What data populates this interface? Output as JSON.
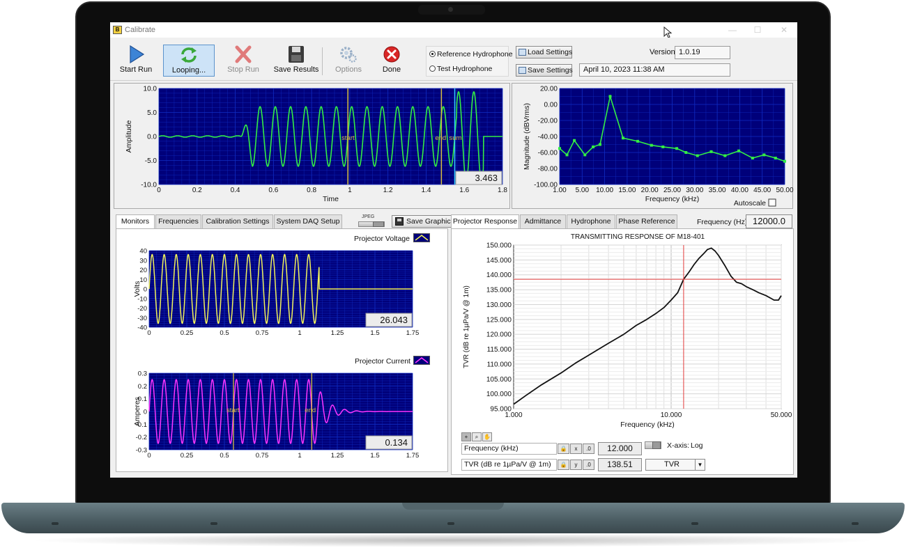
{
  "window": {
    "title": "Calibrate",
    "minimize": "—",
    "maximize": "☐",
    "close": "✕"
  },
  "toolbar": {
    "start_run": "Start Run",
    "looping": "Looping...",
    "stop_run": "Stop Run",
    "save_results": "Save Results",
    "options": "Options",
    "done": "Done",
    "load_settings": "Load Settings",
    "save_settings": "Save Settings",
    "version_label": "Version",
    "version_value": "1.0.19",
    "datetime_value": "April 10, 2023    11:38 AM"
  },
  "hydrophone": {
    "options": [
      "Reference Hydrophone",
      "Test Hydrophone"
    ],
    "selected": "Reference Hydrophone"
  },
  "left_tabs": [
    "Monitors",
    "Frequencies",
    "Calibration Settings",
    "System DAQ Setup"
  ],
  "left_active_tab": "Monitors",
  "save_graphic": {
    "format_label": "JPEG",
    "button": "Save Graphic"
  },
  "right_tabs": [
    "Projector Response",
    "Admittance",
    "Hydrophone",
    "Phase Reference"
  ],
  "right_active_tab": "Projector Response",
  "frequency_control": {
    "label": "Frequency (Hz)",
    "value": "12000.0"
  },
  "tvr_cursors": {
    "rows": [
      {
        "name": "Frequency (kHz)",
        "value": "12.000"
      },
      {
        "name": "TVR (dB re 1µPa/V @ 1m)",
        "value": "138.51"
      }
    ],
    "xaxis_label": "X-axis:",
    "xaxis_value": "Log",
    "ring_value": "TVR"
  },
  "colors": {
    "plot_bg": "#00007a",
    "plot_grid": "#0f2cc4",
    "green_trace": "#33ee44",
    "yellow_trace": "#f3f35a",
    "magenta_trace": "#ff33ff",
    "cursor_yellow": "#d8c040",
    "cursor_cyan": "#33ccff",
    "cursor_red": "#e23c3c"
  },
  "chart_data": [
    {
      "id": "amplitude-chart",
      "type": "line",
      "xlabel": "Time",
      "ylabel": "Amplitude",
      "xlim": [
        0,
        1.8
      ],
      "ylim": [
        -10,
        10
      ],
      "xticks": [
        "0",
        "0.2",
        "0.4",
        "0.6",
        "0.8",
        "1",
        "1.2",
        "1.4",
        "1.6",
        "1.8"
      ],
      "yticks": [
        "10.0",
        "5.0",
        "0.0",
        "-5.0",
        "-10.0"
      ],
      "signal": {
        "onset": 0.43,
        "frequency_cycles_per_unit": 12.5,
        "amplitude": 6.2,
        "late_amplitude": 9.3
      },
      "cursors": [
        {
          "label": "start",
          "x": 0.99
        },
        {
          "label": "end",
          "x": 1.48
        },
        {
          "label": "sum",
          "x": 1.55
        }
      ],
      "readout": "3.463"
    },
    {
      "id": "spectrum-chart",
      "type": "line",
      "xlabel": "Frequency (kHz)",
      "ylabel": "Magnitude (dBVrms)",
      "xlim": [
        1,
        50
      ],
      "ylim": [
        -100,
        20
      ],
      "xticks": [
        "1.00",
        "5.00",
        "10.00",
        "15.00",
        "20.00",
        "25.00",
        "30.00",
        "35.00",
        "40.00",
        "45.00",
        "50.00"
      ],
      "yticks": [
        "20.00",
        "0.00",
        "-20.00",
        "-40.00",
        "-60.00",
        "-80.00",
        "-100.00"
      ],
      "x": [
        1,
        2.6,
        4.2,
        6.5,
        8.3,
        9.8,
        12,
        14.8,
        18,
        21,
        23.5,
        26.5,
        28.5,
        31,
        34,
        37,
        40,
        43,
        45.5,
        48,
        50
      ],
      "y": [
        -55,
        -63,
        -45,
        -63,
        -53,
        -50,
        10,
        -42,
        -46,
        -51,
        -53,
        -55,
        -60,
        -64,
        -59,
        -64,
        -58,
        -67,
        -63,
        -67,
        -71
      ],
      "autoscale_label": "Autoscale"
    },
    {
      "id": "voltage-chart",
      "type": "line",
      "xlabel": "",
      "ylabel": "Volts",
      "legend": "Projector Voltage",
      "xlim": [
        0,
        1.75
      ],
      "ylim": [
        -40,
        40
      ],
      "xticks": [
        "0",
        "0.25",
        "0.5",
        "0.75",
        "1",
        "1.25",
        "1.5",
        "1.75"
      ],
      "yticks": [
        "40",
        "30",
        "20",
        "10",
        "0",
        "-10",
        "-20",
        "-30",
        "-40"
      ],
      "signal": {
        "start": 0.0,
        "end": 1.13,
        "frequency_cycles_per_unit": 12.5,
        "amplitude": 36,
        "flat_level": 0
      },
      "readout": "26.043"
    },
    {
      "id": "current-chart",
      "type": "line",
      "xlabel": "",
      "ylabel": "Amperes",
      "legend": "Projector Current",
      "xlim": [
        0,
        1.75
      ],
      "ylim": [
        -0.3,
        0.3
      ],
      "xticks": [
        "0",
        "0.25",
        "0.5",
        "0.75",
        "1",
        "1.25",
        "1.5",
        "1.75"
      ],
      "yticks": [
        "0.3",
        "0.2",
        "0.1",
        "0",
        "-0.1",
        "-0.2",
        "-0.3"
      ],
      "signal": {
        "start": 0.0,
        "end": 1.12,
        "frequency_cycles_per_unit": 12.5,
        "amplitude": 0.25
      },
      "cursors": [
        {
          "label": "start",
          "x": 0.56
        },
        {
          "label": "end",
          "x": 1.08
        }
      ],
      "readout": "0.134"
    },
    {
      "id": "tvr-chart",
      "type": "line",
      "title": "TRANSMITTING RESPONSE OF M18-401",
      "xlabel": "Frequency (kHz)",
      "ylabel": "TVR (dB re 1µPa/V @ 1m)",
      "xscale": "log",
      "xlim": [
        1,
        50
      ],
      "ylim": [
        95,
        150
      ],
      "xticks": [
        "1.000",
        "10.000",
        "50.000"
      ],
      "yticks": [
        "150.000",
        "145.000",
        "140.000",
        "135.000",
        "130.000",
        "125.000",
        "120.000",
        "115.000",
        "110.000",
        "105.000",
        "100.000",
        "95.000"
      ],
      "x": [
        1,
        1.2,
        1.5,
        2,
        2.5,
        3,
        4,
        5,
        6,
        7,
        8,
        9,
        10,
        11,
        12,
        13,
        14,
        15,
        16,
        17,
        18,
        19,
        20,
        22,
        24,
        26,
        28,
        30,
        33,
        36,
        40,
        45,
        48,
        50
      ],
      "y": [
        96.5,
        99.5,
        103,
        107,
        110.5,
        113,
        117,
        120,
        123,
        125,
        127,
        129,
        131.5,
        134,
        138.5,
        141,
        143.5,
        145.5,
        147,
        148.5,
        149,
        148,
        146.5,
        143,
        139.5,
        137.5,
        137,
        136,
        135,
        134,
        133,
        131.5,
        131.5,
        133
      ],
      "cursor": {
        "x": 12,
        "y": 138.51
      }
    }
  ]
}
